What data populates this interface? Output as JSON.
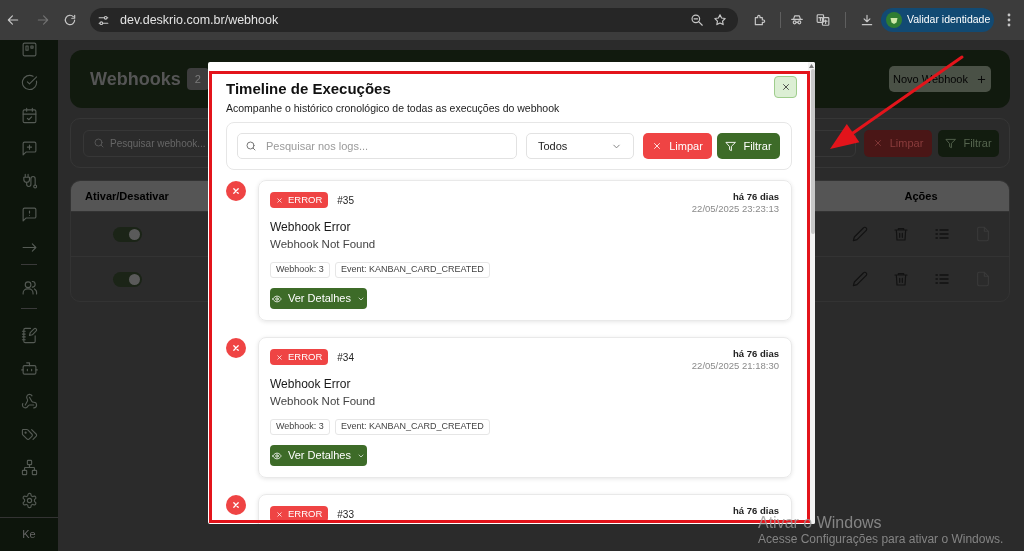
{
  "browser": {
    "url": "dev.deskrio.com.br/webhook",
    "profile_button": "Validar identidade"
  },
  "sidebar": {
    "user_initials": "Ke"
  },
  "page": {
    "title": "Webhooks",
    "count": "2",
    "new_button": "Novo Webhook",
    "search": {
      "placeholder": "Pesquisar webhook..."
    },
    "clear_button": "Limpar",
    "filter_button": "Filtrar",
    "table": {
      "columns": [
        "Ativar/Desativar",
        "Ações"
      ],
      "rows": [
        {
          "on": true
        },
        {
          "on": true
        }
      ]
    }
  },
  "modal": {
    "title": "Timeline de Execuções",
    "subtitle": "Acompanhe o histórico cronológico de todas as execuções do webhook",
    "search": {
      "placeholder": "Pesquisar nos logs..."
    },
    "status_filter": "Todos",
    "clear_button": "Limpar",
    "filter_button": "Filtrar",
    "entries": [
      {
        "status": "ERROR",
        "number": "#35",
        "relative_time": "há 76 dias",
        "timestamp": "22/05/2025 23:23:13",
        "title": "Webhook Error",
        "message": "Webhook Not Found",
        "tags": [
          "Webhook: 3",
          "Event: KANBAN_CARD_CREATED"
        ],
        "details_button": "Ver Detalhes"
      },
      {
        "status": "ERROR",
        "number": "#34",
        "relative_time": "há 76 dias",
        "timestamp": "22/05/2025 21:18:30",
        "title": "Webhook Error",
        "message": "Webhook Not Found",
        "tags": [
          "Webhook: 3",
          "Event: KANBAN_CARD_CREATED"
        ],
        "details_button": "Ver Detalhes"
      },
      {
        "status": "ERROR",
        "number": "#33",
        "relative_time": "há 76 dias"
      }
    ]
  },
  "windows_activation": {
    "title": "Ativar o Windows",
    "message": "Acesse Configurações para ativar o Windows."
  }
}
